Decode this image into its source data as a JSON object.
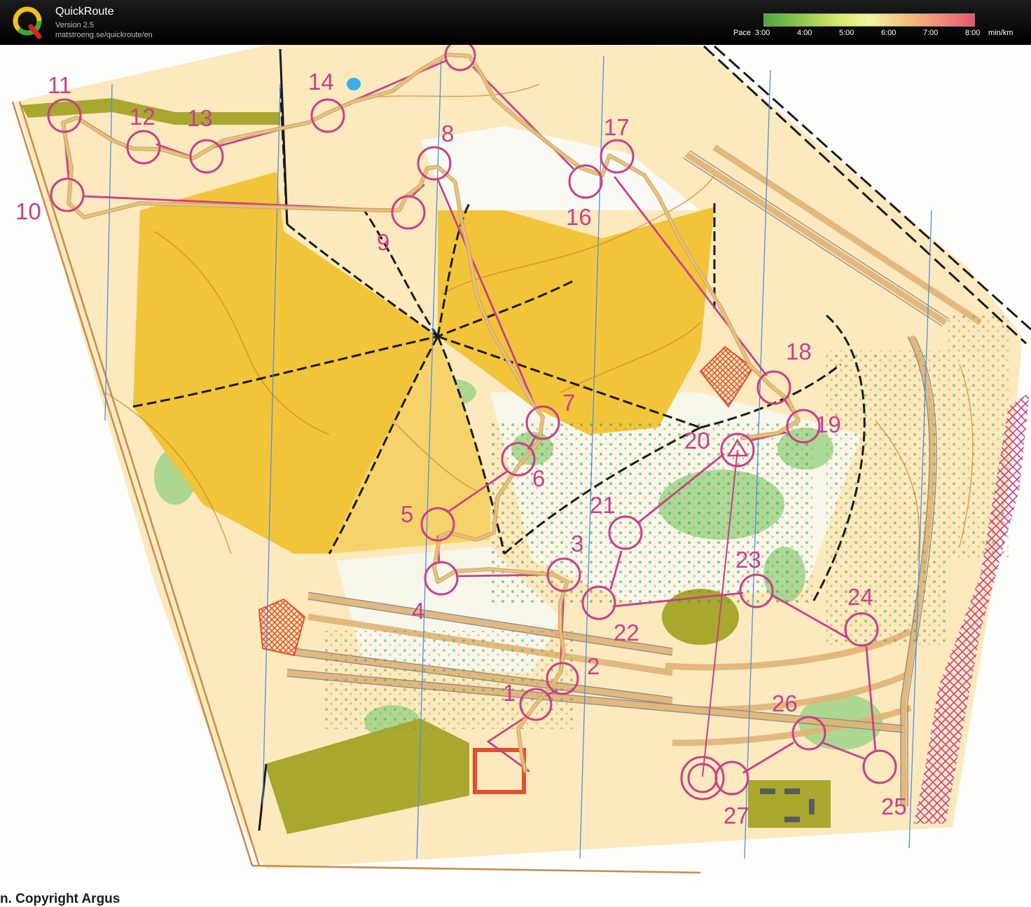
{
  "app": {
    "title": "QuickRoute",
    "version": "Version 2.5",
    "url": "matstroeng.se/quickroute/en",
    "logo_letter": "Q"
  },
  "pace_scale": {
    "label": "Pace",
    "ticks": [
      "3:00",
      "4:00",
      "5:00",
      "6:00",
      "7:00",
      "8:00"
    ],
    "unit": "min/km"
  },
  "map": {
    "copyright": "n. Copyright Argus",
    "colors": {
      "course": "#c8408a",
      "route_fast": "#8fd06a",
      "route_slow": "#f2a58a",
      "open_land": "#f2c43a",
      "rough_open": "#fbe3ae",
      "olive": "#a8a72e",
      "forest_green": "#7cc46a",
      "paved": "#f3d49a",
      "meridian": "#4a90e2"
    },
    "controls": [
      {
        "label": "1"
      },
      {
        "label": "2"
      },
      {
        "label": "3"
      },
      {
        "label": "4"
      },
      {
        "label": "5"
      },
      {
        "label": "6"
      },
      {
        "label": "7"
      },
      {
        "label": "8"
      },
      {
        "label": "9"
      },
      {
        "label": "10"
      },
      {
        "label": "11"
      },
      {
        "label": "12"
      },
      {
        "label": "13"
      },
      {
        "label": "14"
      },
      {
        "label": "16"
      },
      {
        "label": "17"
      },
      {
        "label": "18"
      },
      {
        "label": "19"
      },
      {
        "label": "20"
      },
      {
        "label": "21"
      },
      {
        "label": "22"
      },
      {
        "label": "23"
      },
      {
        "label": "24"
      },
      {
        "label": "25"
      },
      {
        "label": "26"
      },
      {
        "label": "27"
      }
    ]
  }
}
